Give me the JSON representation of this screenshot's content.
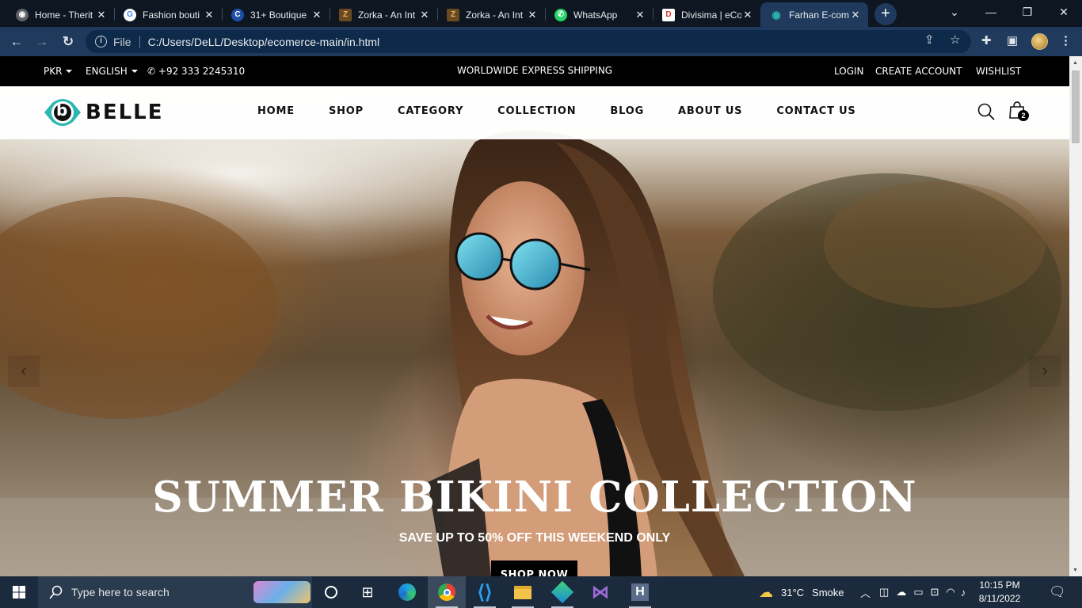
{
  "browser": {
    "tabs": [
      {
        "title": "Home - Therit",
        "icon": "globe-icon",
        "color": "#9aa0a6",
        "glyph": "◉"
      },
      {
        "title": "Fashion bouti",
        "icon": "google-icon",
        "color": "#ffffff",
        "glyph": "G"
      },
      {
        "title": "31+ Boutique",
        "icon": "c-logo-icon",
        "color": "#3b82f6",
        "glyph": "C"
      },
      {
        "title": "Zorka - An Int",
        "icon": "zorka-icon",
        "color": "#c98a3b",
        "glyph": "Z"
      },
      {
        "title": "Zorka - An Int",
        "icon": "zorka-icon",
        "color": "#c98a3b",
        "glyph": "Z"
      },
      {
        "title": "WhatsApp",
        "icon": "whatsapp-icon",
        "color": "#25d366",
        "glyph": "✆"
      },
      {
        "title": "Divisima | eCo",
        "icon": "divisima-icon",
        "color": "#e05050",
        "glyph": "D"
      },
      {
        "title": "Farhan E-com",
        "icon": "eye-icon",
        "color": "#2bb7b0",
        "glyph": "◉"
      }
    ],
    "address": {
      "scheme_label": "File",
      "url": "C:/Users/DeLL/Desktop/ecomerce-main/in.html"
    }
  },
  "site": {
    "topbar": {
      "currency": "PKR",
      "language": "ENGLISH",
      "phone": "+92 333 2245310",
      "shipping": "WORLDWIDE EXPRESS SHIPPING",
      "links": [
        "LOGIN",
        "CREATE ACCOUNT",
        "WISHLIST"
      ]
    },
    "brand": "BELLE",
    "brand_letter": "b",
    "brand_color": "#2bb7b0",
    "menu": [
      "HOME",
      "SHOP",
      "CATEGORY",
      "COLLECTION",
      "BLOG",
      "ABOUT US",
      "CONTACT US"
    ],
    "cart_count": "2",
    "hero": {
      "title": "SUMMER BIKINI COLLECTION",
      "subtitle": "SAVE UP TO 50% OFF THIS WEEKEND ONLY",
      "cta": "SHOP NOW",
      "prev": "‹",
      "next": "›"
    }
  },
  "taskbar": {
    "search_placeholder": "Type here to search",
    "weather": {
      "temp": "31°C",
      "condition": "Smoke"
    },
    "time": "10:15 PM",
    "date": "8/11/2022"
  }
}
